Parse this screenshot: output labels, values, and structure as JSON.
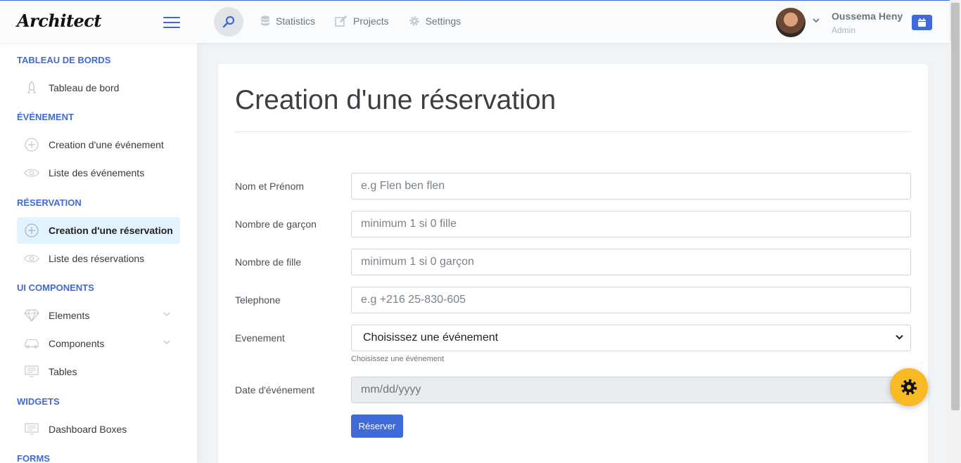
{
  "header": {
    "logo": "Architect",
    "nav": [
      {
        "label": "Statistics",
        "icon": "database-icon"
      },
      {
        "label": "Projects",
        "icon": "edit-icon"
      },
      {
        "label": "Settings",
        "icon": "gear-icon"
      }
    ],
    "user": {
      "name": "Oussema Heny",
      "role": "Admin"
    }
  },
  "sidebar": {
    "sections": [
      {
        "title": "TABLEAU DE BORDS"
      },
      {
        "title": "ÉVÉNEMENT"
      },
      {
        "title": "RÉSERVATION"
      },
      {
        "title": "UI COMPONENTS"
      },
      {
        "title": "WIDGETS"
      },
      {
        "title": "FORMS"
      }
    ],
    "items": [
      {
        "label": "Tableau de bord",
        "icon": "rocket-icon"
      },
      {
        "label": "Creation d'une événement",
        "icon": "plus-circle-icon"
      },
      {
        "label": "Liste des événements",
        "icon": "eye-icon"
      },
      {
        "label": "Creation d'une réservation",
        "icon": "plus-circle-icon",
        "active": true
      },
      {
        "label": "Liste des réservations",
        "icon": "eye-icon"
      },
      {
        "label": "Elements",
        "icon": "diamond-icon"
      },
      {
        "label": "Components",
        "icon": "car-icon"
      },
      {
        "label": "Tables",
        "icon": "monitor-icon"
      },
      {
        "label": "Dashboard Boxes",
        "icon": "monitor-icon"
      }
    ]
  },
  "form": {
    "title": "Creation d'une réservation",
    "fields": [
      {
        "label": "Nom et Prénom",
        "placeholder": "e.g Flen ben flen"
      },
      {
        "label": "Nombre de garçon",
        "placeholder": "minimum 1 si 0 fille"
      },
      {
        "label": "Nombre de fille",
        "placeholder": "minimum 1 si 0 garçon"
      },
      {
        "label": "Telephone",
        "placeholder": "e.g +216 25-830-605"
      },
      {
        "label": "Evenement",
        "selected": "Choisissez une événement",
        "help": "Choisissez une événement"
      },
      {
        "label": "Date d'événement",
        "value": "mm/dd/yyyy"
      }
    ],
    "submit_label": "Réserver"
  },
  "colors": {
    "accent": "#3f6ad8",
    "fab": "#f7b924",
    "active_bg": "#e0f3ff"
  }
}
